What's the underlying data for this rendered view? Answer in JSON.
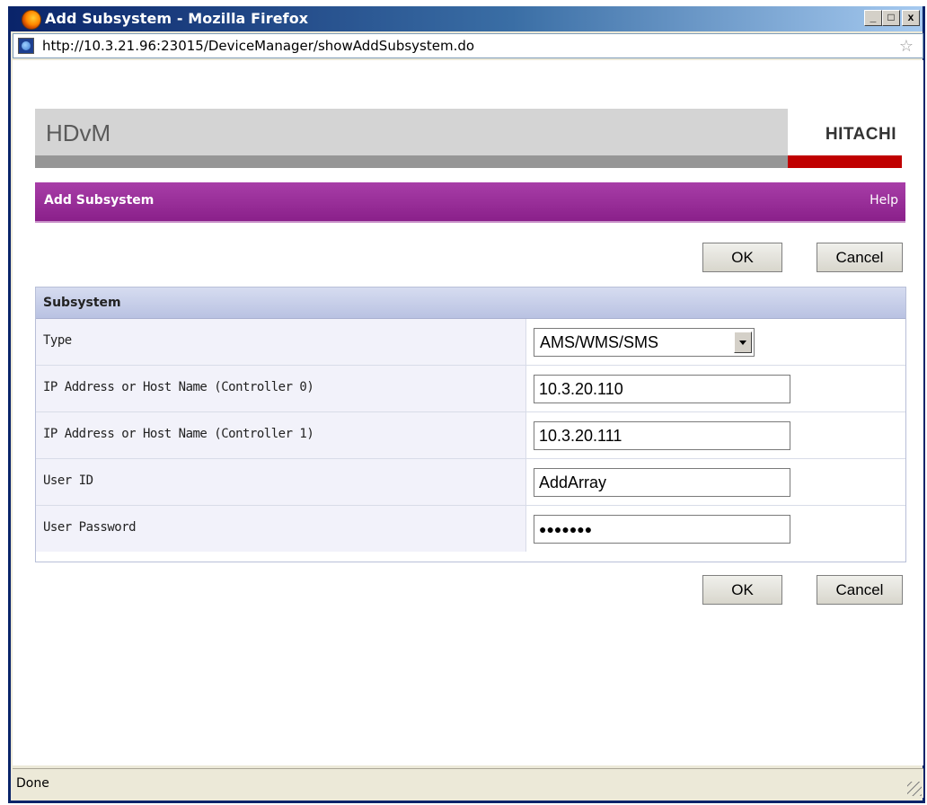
{
  "window": {
    "title": "Add Subsystem - Mozilla Firefox",
    "min_label": "_",
    "max_label": "□",
    "close_label": "x",
    "logo_icon": "firefox-logo-icon"
  },
  "address_bar": {
    "url": "http://10.3.21.96:23015/DeviceManager/showAddSubsystem.do",
    "page_icon": "globe-icon",
    "bookmark_icon": "star-icon",
    "bookmark_glyph": "☆"
  },
  "header": {
    "product": "HDvM",
    "brand": "HITACHI",
    "brand_color": "#c00000"
  },
  "titlebar": {
    "title": "Add Subsystem",
    "help": "Help",
    "color": "#8a208a"
  },
  "buttons": {
    "ok": "OK",
    "cancel": "Cancel"
  },
  "panel": {
    "title": "Subsystem",
    "rows": [
      {
        "label": "Type",
        "value": "AMS/WMS/SMS",
        "kind": "select"
      },
      {
        "label": "IP Address or Host Name (Controller 0)",
        "value": "10.3.20.110",
        "kind": "text"
      },
      {
        "label": "IP Address or Host Name (Controller 1)",
        "value": "10.3.20.111",
        "kind": "text"
      },
      {
        "label": "User ID",
        "value": "AddArray",
        "kind": "text"
      },
      {
        "label": "User Password",
        "value": "●●●●●●●",
        "kind": "password"
      }
    ]
  },
  "status": {
    "text": "Done"
  }
}
